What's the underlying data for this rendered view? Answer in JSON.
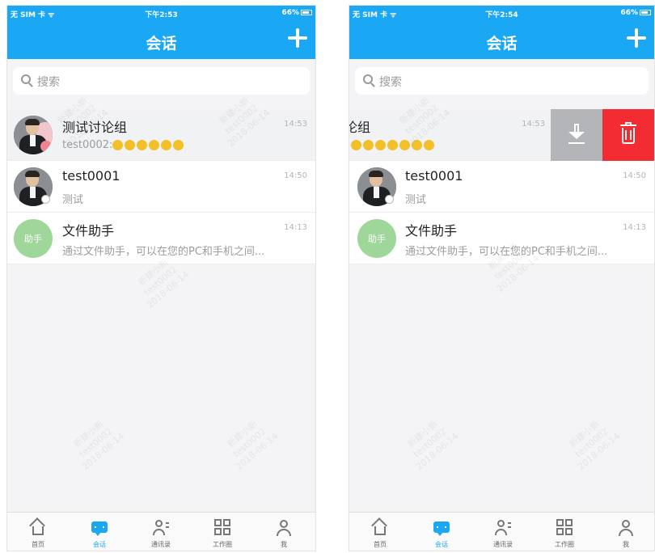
{
  "screens": [
    {
      "status": {
        "carrier": "无 SIM 卡 ᯤ",
        "time": "下午2:53",
        "battery": "66%"
      },
      "title": "会话",
      "search_placeholder": "搜索",
      "conversations": [
        {
          "name": "测试讨论组",
          "time": "14:53",
          "preview": "test0002:"
        },
        {
          "name": "test0001",
          "time": "14:50",
          "preview": "测试"
        },
        {
          "name": "文件助手",
          "time": "14:13",
          "preview": "通过文件助手，可以在您的PC和手机之间...",
          "avatar_text": "助手"
        }
      ]
    },
    {
      "status": {
        "carrier": "无 SIM 卡 ᯤ",
        "time": "下午2:54",
        "battery": "66%"
      },
      "title": "会话",
      "search_placeholder": "搜索",
      "conversations": [
        {
          "name": "论组",
          "time": "14:53"
        },
        {
          "name": "test0001",
          "time": "14:50",
          "preview": "测试"
        },
        {
          "name": "文件助手",
          "time": "14:13",
          "preview": "通过文件助手，可以在您的PC和手机之间...",
          "avatar_text": "助手"
        }
      ]
    }
  ],
  "tabs": [
    {
      "label": "首页",
      "icon": "home-icon"
    },
    {
      "label": "会话",
      "icon": "chat-icon",
      "active": true
    },
    {
      "label": "通讯录",
      "icon": "contacts-icon"
    },
    {
      "label": "工作圈",
      "icon": "workspace-grid-icon"
    },
    {
      "label": "我",
      "icon": "profile-icon"
    }
  ],
  "watermark": {
    "line1": "新建小新",
    "line2": "test0002",
    "line3": "2018-06-14"
  },
  "colors": {
    "header": "#1aa7f4",
    "delete": "#f32b33",
    "archive": "#b3b5b9",
    "helper_avatar": "#9fd79a"
  }
}
